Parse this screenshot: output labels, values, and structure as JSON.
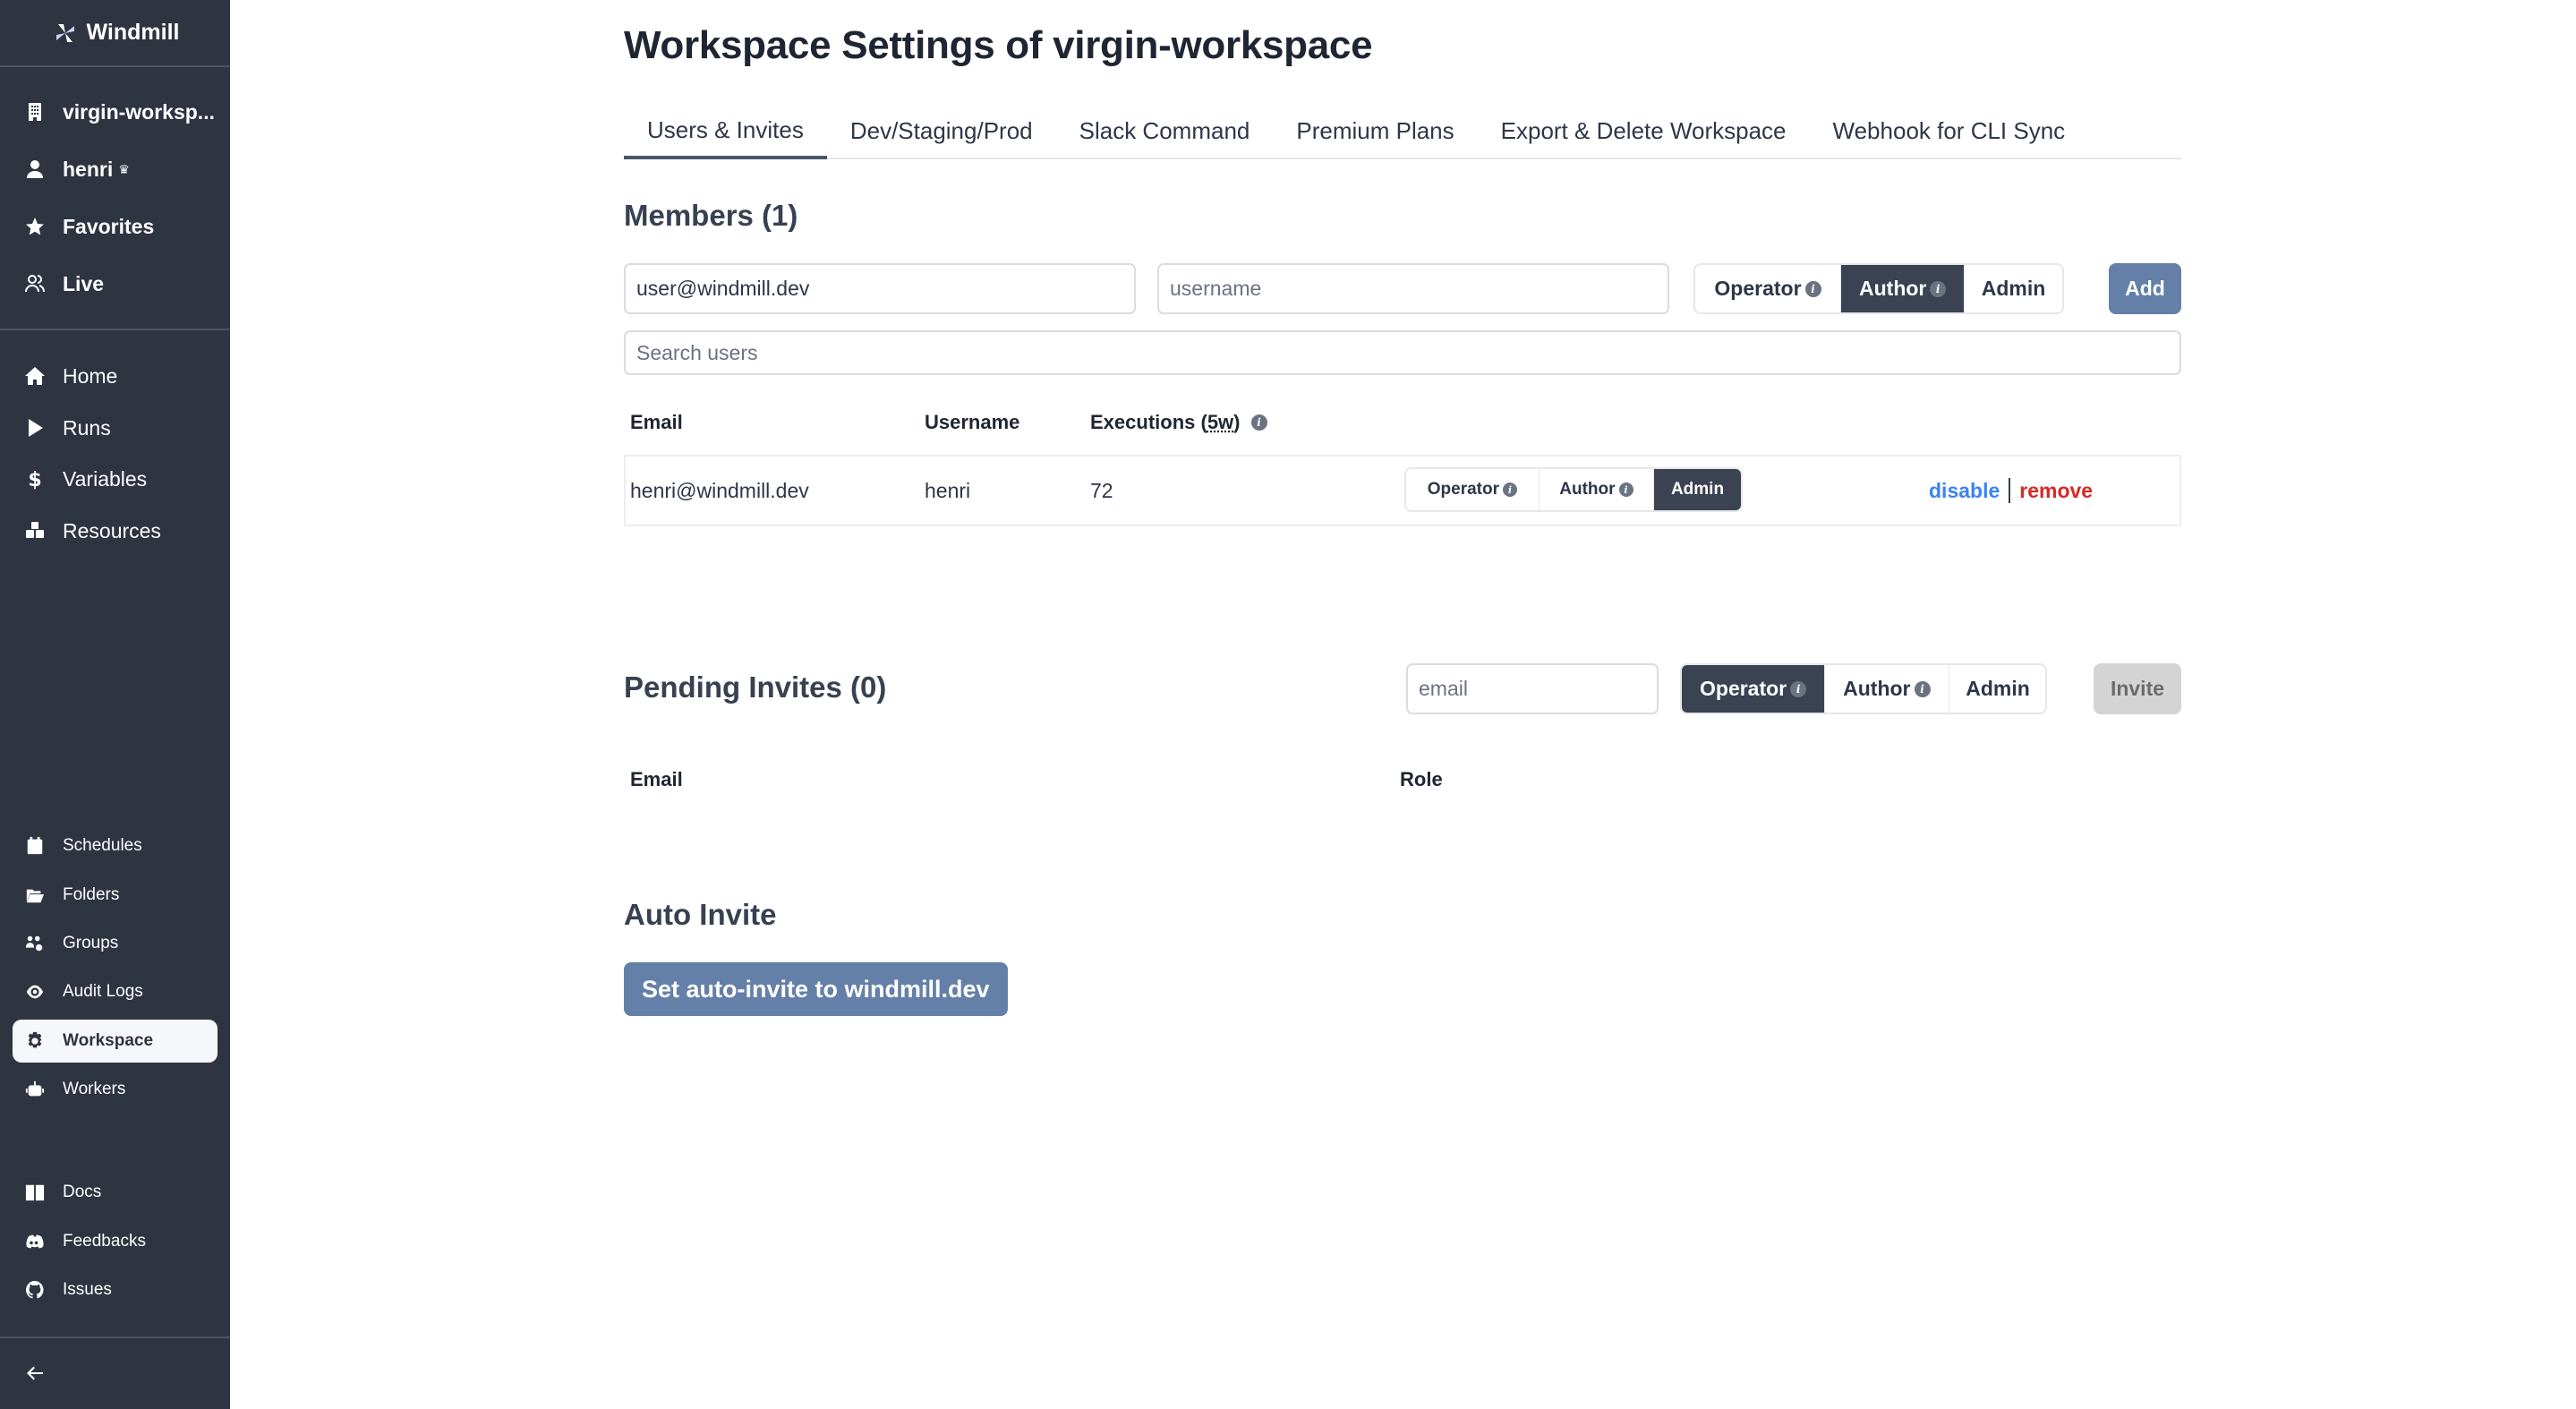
{
  "sidebar": {
    "logo": "Windmill",
    "top_items": [
      {
        "label": "virgin-worksp...",
        "icon": "building-icon"
      },
      {
        "label": "henri",
        "icon": "user-icon",
        "badge": "♛"
      },
      {
        "label": "Favorites",
        "icon": "star-icon"
      },
      {
        "label": "Live",
        "icon": "users-icon"
      }
    ],
    "main_items": [
      {
        "label": "Home",
        "icon": "home-icon"
      },
      {
        "label": "Runs",
        "icon": "play-icon"
      },
      {
        "label": "Variables",
        "icon": "dollar-icon"
      },
      {
        "label": "Resources",
        "icon": "cubes-icon"
      }
    ],
    "settings_items": [
      {
        "label": "Schedules",
        "icon": "calendar-icon"
      },
      {
        "label": "Folders",
        "icon": "folder-open-icon"
      },
      {
        "label": "Groups",
        "icon": "users-cog-icon"
      },
      {
        "label": "Audit Logs",
        "icon": "eye-icon"
      },
      {
        "label": "Workspace",
        "icon": "gear-icon",
        "active": true
      },
      {
        "label": "Workers",
        "icon": "robot-icon"
      }
    ],
    "help_items": [
      {
        "label": "Docs",
        "icon": "book-icon"
      },
      {
        "label": "Feedbacks",
        "icon": "discord-icon"
      },
      {
        "label": "Issues",
        "icon": "github-icon"
      }
    ],
    "collapse_icon": "arrow-left-icon"
  },
  "page": {
    "title": "Workspace Settings of virgin-workspace",
    "tabs": [
      {
        "label": "Users & Invites",
        "active": true
      },
      {
        "label": "Dev/Staging/Prod"
      },
      {
        "label": "Slack Command"
      },
      {
        "label": "Premium Plans"
      },
      {
        "label": "Export & Delete Workspace"
      },
      {
        "label": "Webhook for CLI Sync"
      }
    ]
  },
  "members": {
    "heading": "Members (1)",
    "email_input_value": "user@windmill.dev",
    "username_placeholder": "username",
    "roles": [
      "Operator",
      "Author",
      "Admin"
    ],
    "selected_role": "Author",
    "add_label": "Add",
    "search_placeholder": "Search users",
    "columns": {
      "email": "Email",
      "username": "Username",
      "executions_prefix": "Executions (",
      "executions_unit": "5w",
      "executions_suffix": ")"
    },
    "rows": [
      {
        "email": "henri@windmill.dev",
        "username": "henri",
        "executions": "72",
        "role": "Admin",
        "disable_label": "disable",
        "remove_label": "remove"
      }
    ]
  },
  "pending": {
    "heading": "Pending Invites (0)",
    "email_placeholder": "email",
    "roles": [
      "Operator",
      "Author",
      "Admin"
    ],
    "selected_role": "Operator",
    "invite_label": "Invite",
    "columns": {
      "email": "Email",
      "role": "Role"
    }
  },
  "auto_invite": {
    "heading": "Auto Invite",
    "button_label": "Set auto-invite to windmill.dev"
  },
  "colors": {
    "sidebar_bg": "#2e3440",
    "primary_button": "#6580a8",
    "selected_toggle": "#3b4252",
    "disable_link": "#3b82f6",
    "remove_link": "#dc2626"
  }
}
